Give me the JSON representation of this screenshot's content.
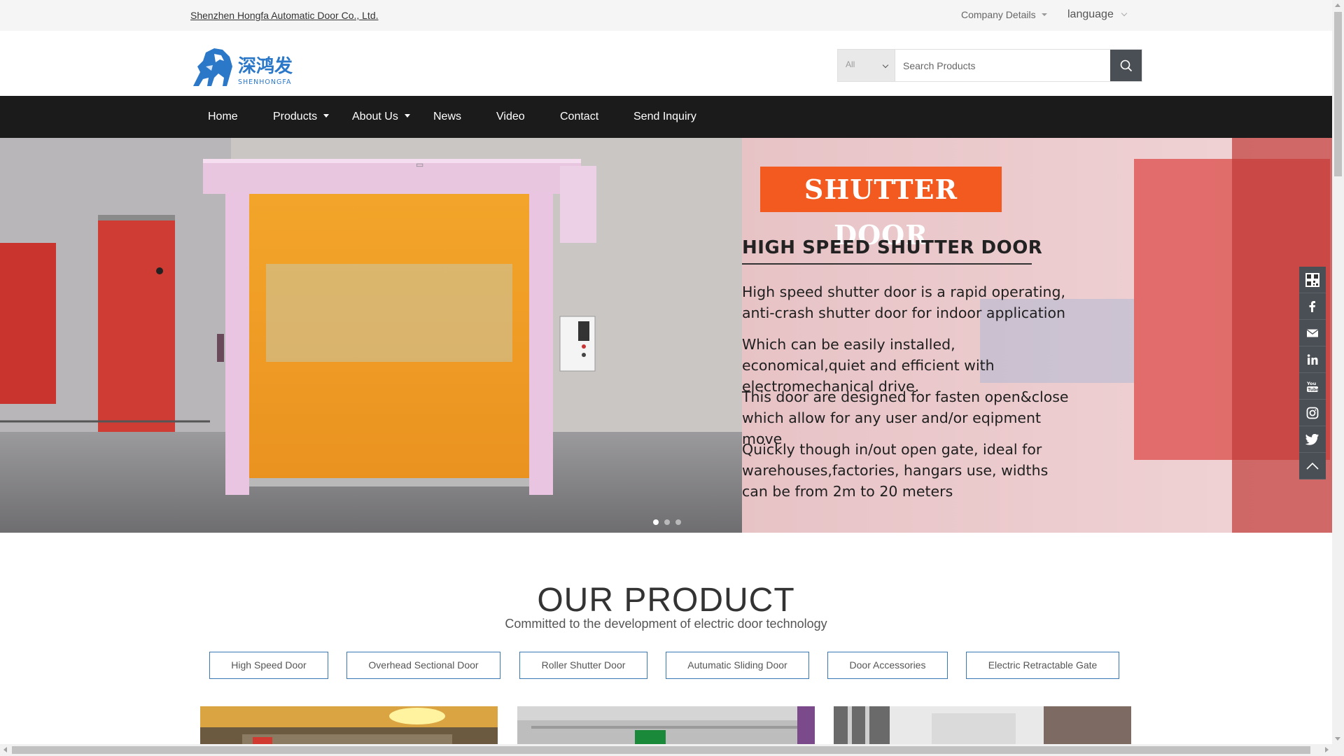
{
  "topbar": {
    "company_name": "Shenzhen Hongfa Automatic Door Co., Ltd.",
    "company_details": "Company Details",
    "language": "language"
  },
  "logo": {
    "brand": "深鸿发",
    "brand_en": "SHENHONGFA"
  },
  "search": {
    "category": "All",
    "placeholder": "Search Products"
  },
  "nav": {
    "items": [
      {
        "label": "Home"
      },
      {
        "label": "Products"
      },
      {
        "label": "About Us"
      },
      {
        "label": "News"
      },
      {
        "label": "Video"
      },
      {
        "label": "Contact"
      },
      {
        "label": "Send Inquiry"
      }
    ]
  },
  "hero": {
    "tag": "SHUTTER DOOR",
    "heading": "HIGH SPEED SHUTTER DOOR",
    "p1": "High speed shutter door is a rapid operating, anti-crash shutter door for indoor application",
    "p2": "Which can be easily installed, economical,quiet and efficient with electromechanical drive.",
    "p3": "This door are designed for fasten open&close which allow for any user and/or eqipment move",
    "p4": "Quickly though in/out open gate, ideal for warehouses,factories, hangars use, widths can be from 2m to 20 meters",
    "slide_count": 3,
    "active_slide": 1
  },
  "products_section": {
    "title": "OUR PRODUCT",
    "subtitle": "Committed to the development of electric door technology",
    "categories": [
      "High Speed Door",
      "Overhead Sectional Door",
      "Roller Shutter Door",
      "Autumatic Sliding Door",
      "Door Accessories",
      "Electric Retractable Gate"
    ]
  },
  "social": {
    "icons": [
      "qr-code-icon",
      "facebook-icon",
      "email-icon",
      "linkedin-icon",
      "youtube-icon",
      "instagram-icon",
      "twitter-icon",
      "back-to-top-icon"
    ]
  },
  "colors": {
    "nav_bg": "#1b1b1b",
    "accent_orange": "#f25a1f",
    "door_orange": "#f0a324",
    "button_border": "#3a78b5",
    "social_bg": "#4a4f55",
    "logo_blue": "#2b78c9"
  }
}
